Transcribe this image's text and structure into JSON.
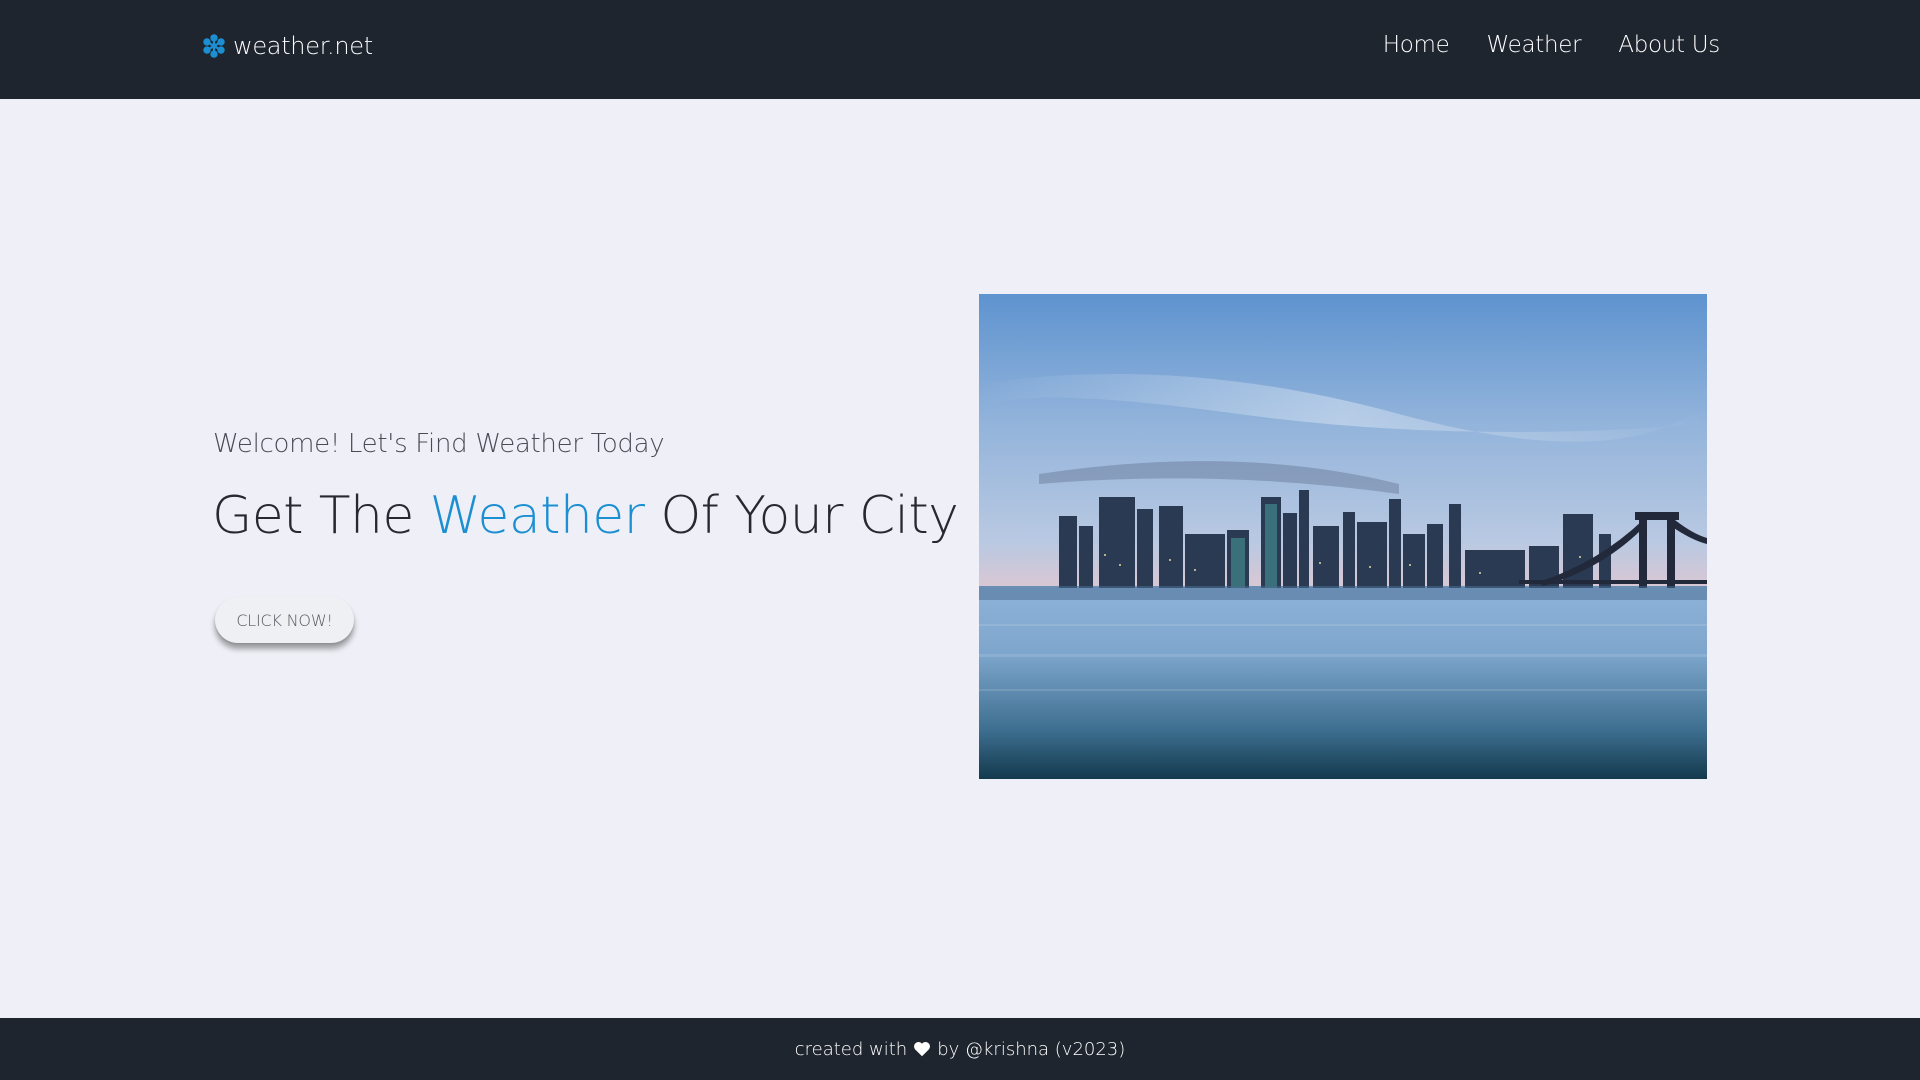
{
  "navbar": {
    "brand": {
      "icon": "snowflake-icon",
      "label": "weather.net",
      "icon_color": "#1b8fd2"
    },
    "links": [
      {
        "label": "Home"
      },
      {
        "label": "Weather"
      },
      {
        "label": "About Us"
      }
    ]
  },
  "hero": {
    "subtitle": "Welcome! Let's Find Weather Today",
    "headline_pre": "Get The ",
    "headline_accent": "Weather",
    "headline_post": " Of Your City",
    "accent_color": "#1b8fd2",
    "cta_label": "CLICK NOW!"
  },
  "footer": {
    "text_pre": "created with",
    "icon": "heart-icon",
    "text_post": "by @krishna (v2023)"
  },
  "colors": {
    "nav_background": "#1f252e",
    "page_background": "#eff0f7",
    "accent": "#1b8fd2"
  }
}
